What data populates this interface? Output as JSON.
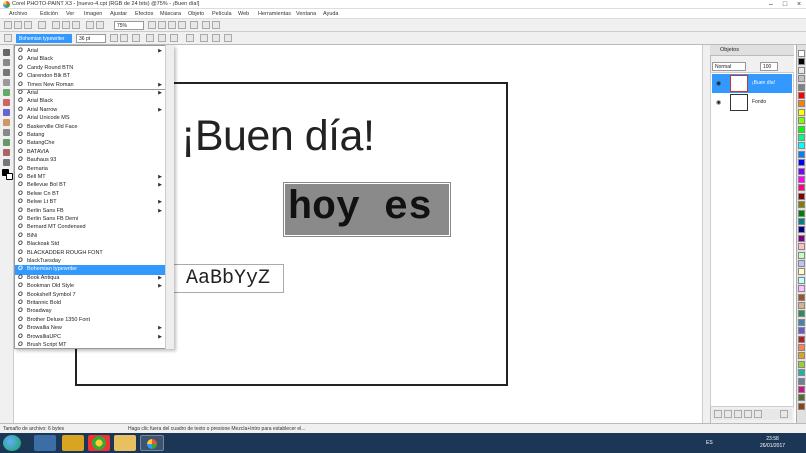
{
  "window": {
    "title": "Corel PHOTO-PAINT X3 - [nuevo-4.cpt (RGB de 24 bits) @75% - ¡Buen día!]"
  },
  "menu": [
    "Archivo",
    "Edición",
    "Ver",
    "Imagen",
    "Ajustar",
    "Efectos",
    "Máscara",
    "Objeto",
    "Película",
    "Web",
    "Herramientas",
    "Ventana",
    "Ayuda"
  ],
  "toolbar": {
    "zoom": "75%"
  },
  "propbar": {
    "font": "Bohemian typewriter",
    "size": "36 pt"
  },
  "canvas": {
    "line1": "¡Buen día!",
    "line2": "hoy es",
    "preview": "AaBbYyZ"
  },
  "fontlist": {
    "selected": "Bohemian typewriter",
    "items": [
      {
        "name": "Arial",
        "submenu": true
      },
      {
        "name": "Arial Black",
        "submenu": false
      },
      {
        "name": "Candy Round BTN",
        "submenu": false
      },
      {
        "name": "Clarendon Blk BT",
        "submenu": false
      },
      {
        "name": "Times New Roman",
        "submenu": true
      },
      {
        "name": "Arial",
        "submenu": true
      },
      {
        "name": "Arial Black",
        "submenu": false
      },
      {
        "name": "Arial Narrow",
        "submenu": true
      },
      {
        "name": "Arial Unicode MS",
        "submenu": false
      },
      {
        "name": "Baskerville Old Face",
        "submenu": false
      },
      {
        "name": "Batang",
        "submenu": false
      },
      {
        "name": "BatangChe",
        "submenu": false
      },
      {
        "name": "BATAVIA",
        "submenu": false
      },
      {
        "name": "Bauhaus 93",
        "submenu": false
      },
      {
        "name": "Bernaria",
        "submenu": false
      },
      {
        "name": "Bell MT",
        "submenu": true
      },
      {
        "name": "Bellevue Bol BT",
        "submenu": true
      },
      {
        "name": "Belwe Cn BT",
        "submenu": false
      },
      {
        "name": "Belwe Lt BT",
        "submenu": true
      },
      {
        "name": "Berlin Sans FB",
        "submenu": true
      },
      {
        "name": "Berlin Sans FB Demi",
        "submenu": false
      },
      {
        "name": "Bernard MT Condensed",
        "submenu": false
      },
      {
        "name": "BiNi",
        "submenu": false
      },
      {
        "name": "Blackoak Std",
        "submenu": false
      },
      {
        "name": "BLACKADDER ROUGH FONT",
        "submenu": false
      },
      {
        "name": "blackTuesday",
        "submenu": false
      },
      {
        "name": "Bohemian typewriter",
        "submenu": false
      },
      {
        "name": "Book Antiqua",
        "submenu": true
      },
      {
        "name": "Bookman Old Style",
        "submenu": true
      },
      {
        "name": "Bookshelf Symbol 7",
        "submenu": false
      },
      {
        "name": "Britannic Bold",
        "submenu": false
      },
      {
        "name": "Broadway",
        "submenu": false
      },
      {
        "name": "Brother Deluxe 1350 Font",
        "submenu": false
      },
      {
        "name": "Browallia New",
        "submenu": true
      },
      {
        "name": "BrowalliaUPC",
        "submenu": true
      },
      {
        "name": "Brush Script MT",
        "submenu": false
      }
    ]
  },
  "objects_panel": {
    "title": "Objetos",
    "mode": "Normal",
    "opacity": "100",
    "layers": [
      {
        "name": "¡Buen día!",
        "active": true
      },
      {
        "name": "Fondo",
        "active": false
      }
    ]
  },
  "statusbar": {
    "left": "Tamaño de archivo: 6 bytes",
    "hint": "Haga clic fuera del cuadro de texto o presione Mezcla+Intro para establecer el..."
  },
  "taskbar": {
    "lang": "ES",
    "time": "23:58",
    "date": "26/01/2017"
  },
  "colors": {
    "accent": "#3399ff",
    "taskbar": "#1c3656",
    "palette": [
      "#ffffff",
      "#000000",
      "#e8e8e8",
      "#c0c0c0",
      "#808080",
      "#ff0000",
      "#ff8000",
      "#ffff00",
      "#80ff00",
      "#00ff00",
      "#00ff80",
      "#00ffff",
      "#0080ff",
      "#0000ff",
      "#8000ff",
      "#ff00ff",
      "#ff0080",
      "#800000",
      "#808000",
      "#008000",
      "#008080",
      "#000080",
      "#800080",
      "#ffc0c0",
      "#c0ffc0",
      "#c0c0ff",
      "#ffffc0",
      "#c0ffff",
      "#ffc0ff",
      "#a0522d",
      "#d2b48c",
      "#2e8b57",
      "#4682b4",
      "#6a5acd",
      "#b22222",
      "#ff7f50",
      "#daa520",
      "#9acd32",
      "#20b2aa",
      "#708090",
      "#c71585",
      "#556b2f",
      "#8b4513"
    ]
  }
}
